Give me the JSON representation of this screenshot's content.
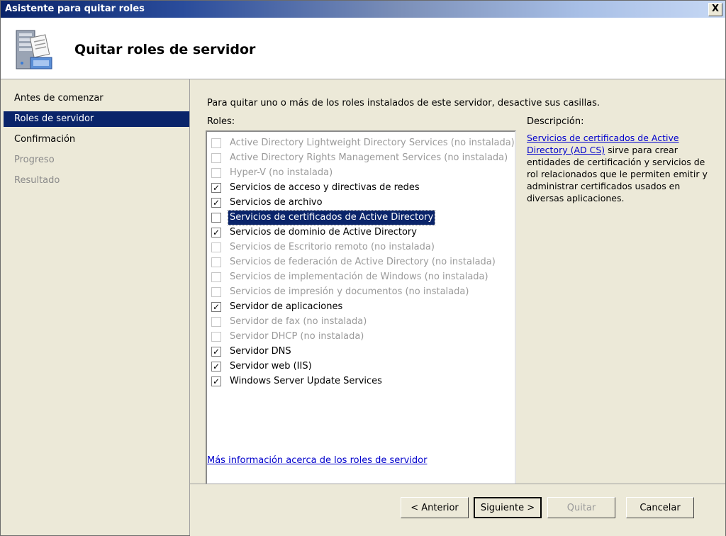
{
  "window": {
    "title": "Asistente para quitar roles",
    "close_label": "X"
  },
  "header": {
    "heading": "Quitar roles de servidor",
    "icon": "server-roles-icon"
  },
  "nav": {
    "items": [
      {
        "label": "Antes de comenzar",
        "state": "normal"
      },
      {
        "label": "Roles de servidor",
        "state": "active"
      },
      {
        "label": "Confirmación",
        "state": "normal"
      },
      {
        "label": "Progreso",
        "state": "disabled"
      },
      {
        "label": "Resultado",
        "state": "disabled"
      }
    ]
  },
  "content": {
    "instructions": "Para quitar uno o más de los roles instalados de este servidor, desactive sus casillas.",
    "roles_label": "Roles:",
    "roles": [
      {
        "label": "Active Directory Lightweight Directory Services (no instalada)",
        "checked": false,
        "disabled": true,
        "selected": false
      },
      {
        "label": "Active Directory Rights Management Services (no instalada)",
        "checked": false,
        "disabled": true,
        "selected": false
      },
      {
        "label": "Hyper-V (no instalada)",
        "checked": false,
        "disabled": true,
        "selected": false
      },
      {
        "label": "Servicios de acceso y directivas de redes",
        "checked": true,
        "disabled": false,
        "selected": false
      },
      {
        "label": "Servicios de archivo",
        "checked": true,
        "disabled": false,
        "selected": false
      },
      {
        "label": "Servicios de certificados de Active Directory",
        "checked": false,
        "disabled": false,
        "selected": true
      },
      {
        "label": "Servicios de dominio de Active Directory",
        "checked": true,
        "disabled": false,
        "selected": false
      },
      {
        "label": "Servicios de Escritorio remoto (no instalada)",
        "checked": false,
        "disabled": true,
        "selected": false
      },
      {
        "label": "Servicios de federación de Active Directory (no instalada)",
        "checked": false,
        "disabled": true,
        "selected": false
      },
      {
        "label": "Servicios de implementación de Windows (no instalada)",
        "checked": false,
        "disabled": true,
        "selected": false
      },
      {
        "label": "Servicios de impresión y documentos (no instalada)",
        "checked": false,
        "disabled": true,
        "selected": false
      },
      {
        "label": "Servidor de aplicaciones",
        "checked": true,
        "disabled": false,
        "selected": false
      },
      {
        "label": "Servidor de fax (no instalada)",
        "checked": false,
        "disabled": true,
        "selected": false
      },
      {
        "label": "Servidor DHCP (no instalada)",
        "checked": false,
        "disabled": true,
        "selected": false
      },
      {
        "label": "Servidor DNS",
        "checked": true,
        "disabled": false,
        "selected": false
      },
      {
        "label": "Servidor web (IIS)",
        "checked": true,
        "disabled": false,
        "selected": false
      },
      {
        "label": "Windows Server Update Services",
        "checked": true,
        "disabled": false,
        "selected": false
      }
    ],
    "description_label": "Descripción:",
    "description_link": "Servicios de certificados de Active Directory (AD CS)",
    "description_text": " sirve para crear entidades de certificación y servicios de rol relacionados que le permiten emitir y administrar certificados usados en diversas aplicaciones.",
    "more_info_link": "Más información acerca de los roles de servidor"
  },
  "footer": {
    "back_label": "< Anterior",
    "next_label": "Siguiente >",
    "remove_label": "Quitar",
    "cancel_label": "Cancelar"
  },
  "colors": {
    "nav_active": "#0a246a",
    "background": "#ece9d8",
    "link": "#0000cc"
  }
}
